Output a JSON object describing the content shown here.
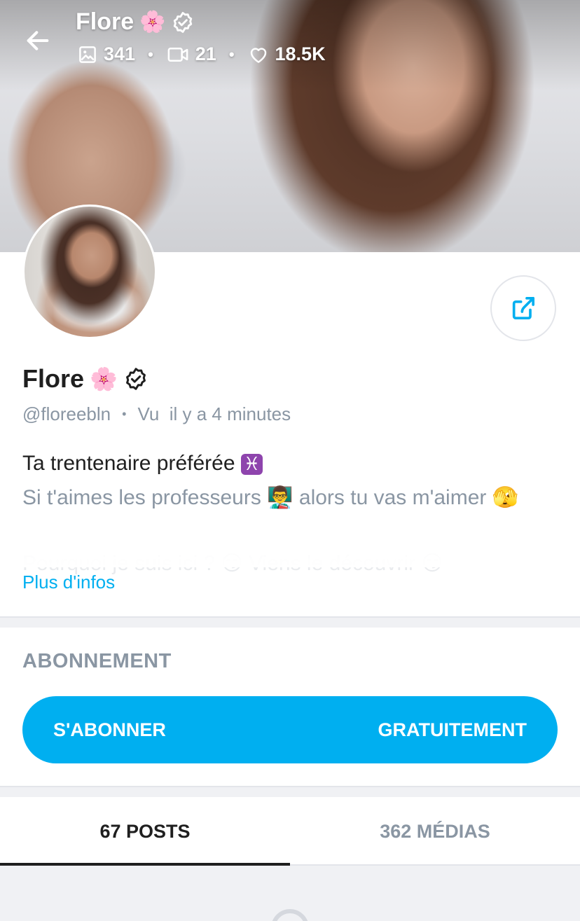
{
  "header": {
    "name": "Flore",
    "name_emoji": "🌸",
    "stats": {
      "photos": "341",
      "videos": "21",
      "likes": "18.5K"
    }
  },
  "profile": {
    "name": "Flore",
    "name_emoji": "🌸",
    "handle": "@floreebln",
    "separator": "•",
    "last_seen": "Vu  il y a 4 minutes"
  },
  "bio": {
    "line1_text": "Ta trentenaire préférée ",
    "line1_emoji": "♓",
    "line2_text": "Si t'aimes les professeurs ",
    "line2_emoji1": "👨‍🏫",
    "line2_text2": " alors tu vas m'aimer ",
    "line2_emoji2": "🫣",
    "line3_text": "Pourquoi je suis ici ? 😏 Viens le découvrir 😏"
  },
  "more_info_label": "Plus d'infos",
  "subscription": {
    "section_title": "ABONNEMENT",
    "button_left": "S'ABONNER",
    "button_right": "GRATUITEMENT"
  },
  "tabs": {
    "posts": "67 POSTS",
    "media": "362 MÉDIAS",
    "active": "posts"
  },
  "icons": {
    "back": "arrow-left-icon",
    "verified": "verified-badge-icon",
    "photos": "image-icon",
    "videos": "video-icon",
    "likes": "heart-icon",
    "share": "share-icon",
    "loader": "loading-spinner-icon"
  },
  "colors": {
    "accent": "#00aff0",
    "muted_text": "#8a96a3",
    "primary_text": "#1f1f1f",
    "divider": "#f0f1f4"
  }
}
